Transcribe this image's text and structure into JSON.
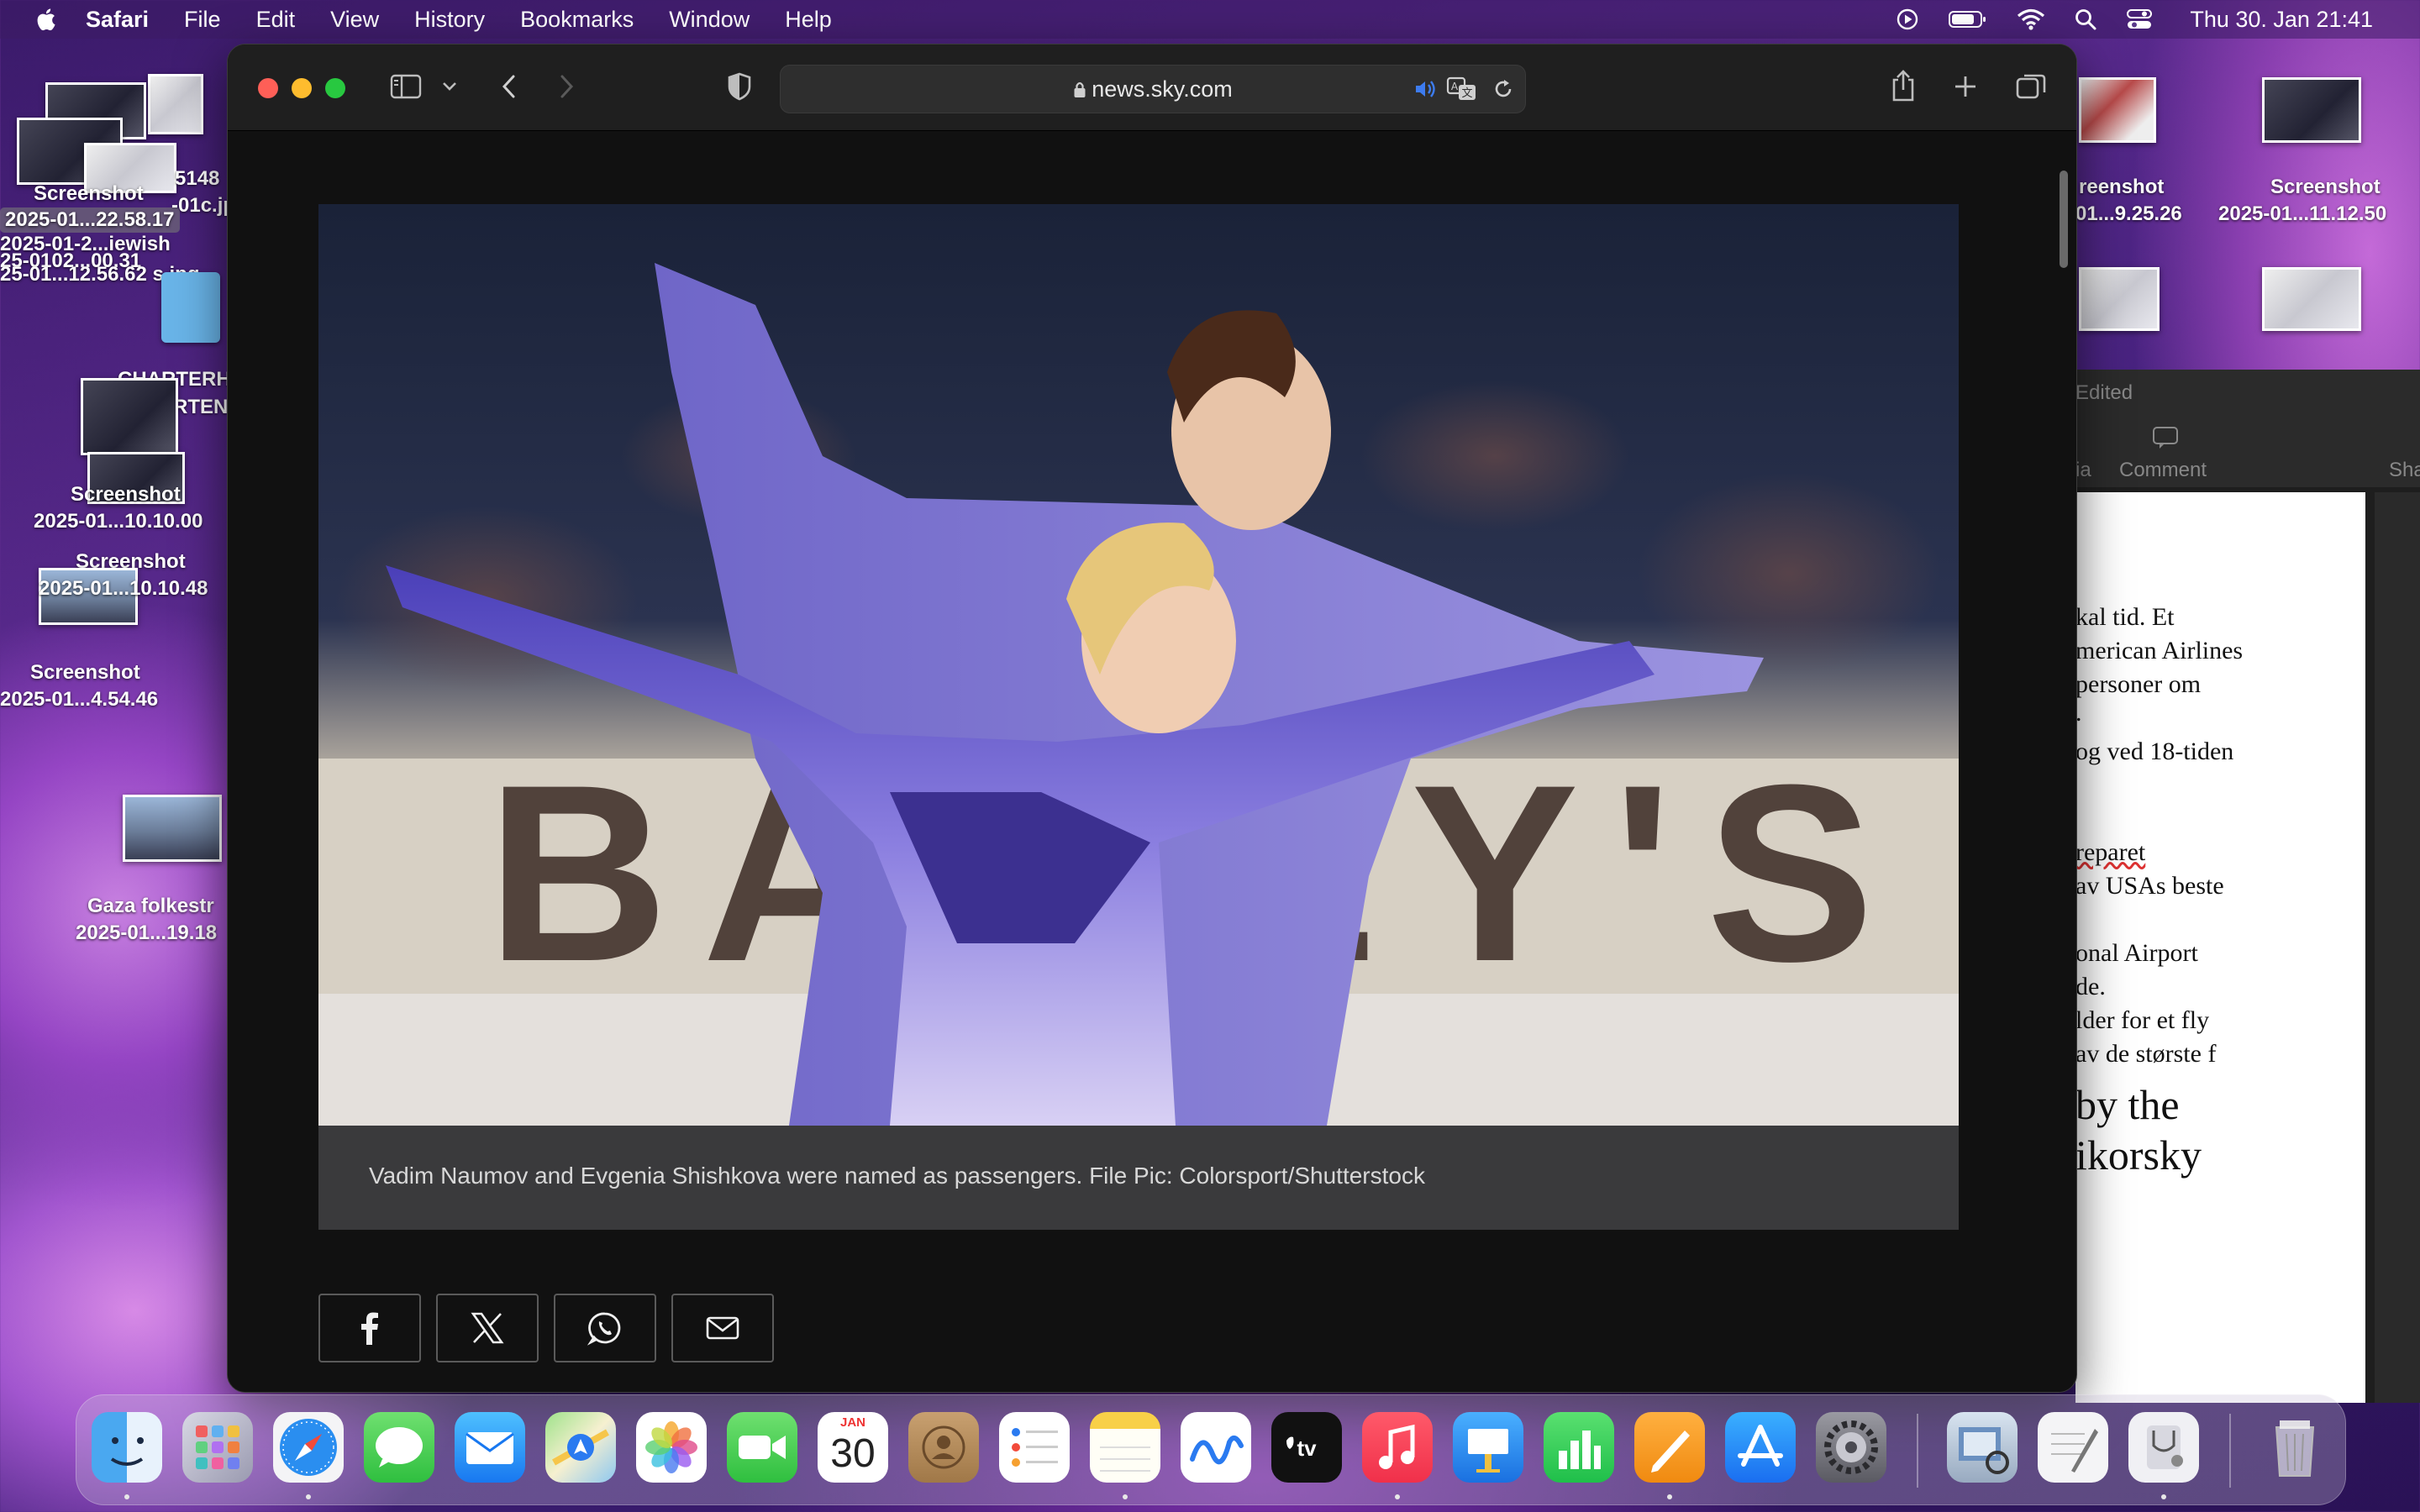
{
  "menubar": {
    "app": "Safari",
    "items": [
      "File",
      "Edit",
      "View",
      "History",
      "Bookmarks",
      "Window",
      "Help"
    ],
    "clock": "Thu 30. Jan  21:41"
  },
  "desktop": {
    "labels": [
      "5148",
      "-01c.jpg",
      "Screenshot",
      "2025-01...22.58.17",
      "2025-01-2...iewish",
      "25-0102...00.31",
      "25-01...12.56.62 s.jpg",
      "CHARTERH",
      "RTEN",
      "Screenshot",
      "2025-01...10.10.00",
      "Screenshot",
      "2025-01...10.10.48",
      "Screenshot",
      "2025-01...4.54.46",
      "Gaza folkestr",
      "2025-01...19.18",
      "reenshot",
      "01...9.25.26",
      "Screenshot",
      "2025-01...11.12.50"
    ]
  },
  "pages_window": {
    "edited": "Edited",
    "media": "ia",
    "comment": "Comment",
    "share": "Sha",
    "lines": [
      "kal tid. Et",
      "merican Airlines",
      "personer om",
      ".",
      " og ved 18-tiden",
      "reparet",
      "av USAs beste",
      "onal Airport",
      "de.",
      "lder for et fly",
      "av de største f"
    ],
    "heading1": "by the",
    "heading2": "ikorsky"
  },
  "safari": {
    "url": "news.sky.com",
    "caption": "Vadim Naumov and Evgenia Shishkova were named as passengers. File Pic: Colorsport/Shutterstock",
    "banner_text": "BAILEY'S"
  },
  "dock": {
    "calendar_month": "JAN",
    "calendar_day": "30",
    "apps": [
      "Finder",
      "Launchpad",
      "Safari",
      "Messages",
      "Mail",
      "Maps",
      "Photos",
      "FaceTime",
      "Calendar",
      "Contacts",
      "Reminders",
      "Notes",
      "Freeform",
      "TV",
      "Music",
      "Keynote",
      "Numbers",
      "Pages",
      "App Store",
      "System Settings",
      "Preview",
      "TextEdit",
      "Disk Utility",
      "Trash"
    ]
  },
  "colors": {
    "safari_toolbar": "#1f1f1f",
    "caption_bg": "#3a3a3c",
    "accent_blue": "#3d7cf0"
  }
}
